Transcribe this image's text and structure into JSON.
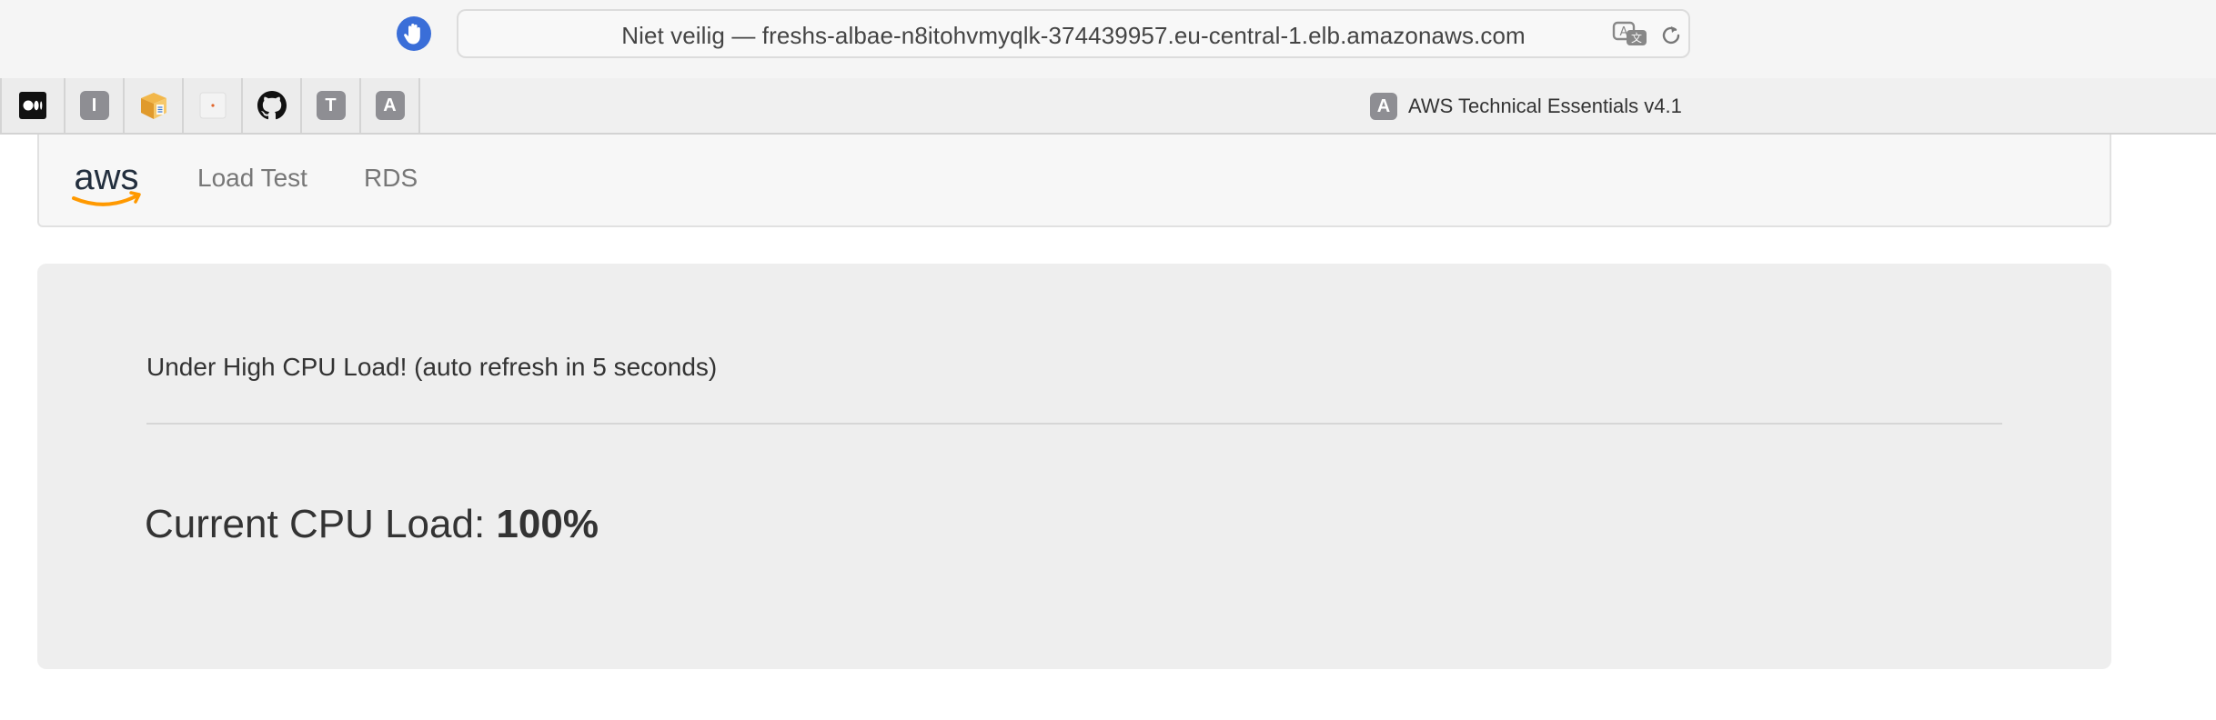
{
  "browser": {
    "address_bar": "Niet veilig — freshs-albae-n8itohvmyqlk-374439957.eu-central-1.elb.amazonaws.com",
    "active_tab_title": "AWS Technical Essentials v4.1",
    "active_tab_favicon_letter": "A",
    "favorites": [
      {
        "icon": "medium-icon"
      },
      {
        "icon": "letter-i-icon",
        "letter": "I"
      },
      {
        "icon": "package-icon"
      },
      {
        "icon": "dot-icon"
      },
      {
        "icon": "github-icon"
      },
      {
        "icon": "letter-t-icon",
        "letter": "T"
      },
      {
        "icon": "letter-a-icon",
        "letter": "A"
      }
    ]
  },
  "navbar": {
    "logo_text": "aws",
    "links": [
      "Load Test",
      "RDS"
    ]
  },
  "main": {
    "status_message": "Under High CPU Load! (auto refresh in 5 seconds)",
    "cpu_label": "Current CPU Load:",
    "cpu_value": "100%"
  },
  "colors": {
    "shield": "#3a6ed8",
    "aws_orange": "#ff9900",
    "aws_dark": "#232f3e",
    "jumbotron": "#eeeeee"
  }
}
